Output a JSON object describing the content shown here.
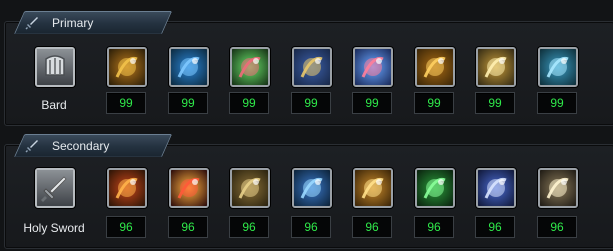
{
  "primary": {
    "header": "Primary",
    "class_name": "Bard",
    "class_icon": "harp-icon",
    "skills": [
      {
        "icon": "golden-horn-icon",
        "level": "99",
        "colors": [
          "#2a1d08",
          "#f2c24a",
          "#b7781c"
        ]
      },
      {
        "icon": "blue-burst-icon",
        "level": "99",
        "colors": [
          "#0c2a3f",
          "#7ec8ff",
          "#2a84d4"
        ]
      },
      {
        "icon": "heart-notes-icon",
        "level": "99",
        "colors": [
          "#153015",
          "#f06a7a",
          "#6adf6a"
        ]
      },
      {
        "icon": "lyre-icon",
        "level": "99",
        "colors": [
          "#182848",
          "#e9c86a",
          "#3c5fa8"
        ]
      },
      {
        "icon": "glowing-heart-icon",
        "level": "99",
        "colors": [
          "#1a2a5a",
          "#ff7e9a",
          "#6aa6ff"
        ]
      },
      {
        "icon": "golden-heart-icon",
        "level": "99",
        "colors": [
          "#3a2608",
          "#ffd060",
          "#a86a14"
        ]
      },
      {
        "icon": "sparkle-cross-icon",
        "level": "99",
        "colors": [
          "#332a14",
          "#fff0b0",
          "#c49a3a"
        ]
      },
      {
        "icon": "wind-swirl-icon",
        "level": "99",
        "colors": [
          "#0e2f3a",
          "#a8e8ff",
          "#3a9ac0"
        ]
      }
    ]
  },
  "secondary": {
    "header": "Secondary",
    "class_name": "Holy Sword",
    "class_icon": "sword-icon",
    "skills": [
      {
        "icon": "flaming-sword-icon",
        "level": "96",
        "colors": [
          "#2a1406",
          "#ffb24a",
          "#c8461a"
        ]
      },
      {
        "icon": "red-slash-icon",
        "level": "96",
        "colors": [
          "#2a0a0a",
          "#ff5a3a",
          "#ffb040"
        ]
      },
      {
        "icon": "planted-sword-icon",
        "level": "96",
        "colors": [
          "#2a220e",
          "#e8d08a",
          "#8a7038"
        ]
      },
      {
        "icon": "ice-shards-icon",
        "level": "96",
        "colors": [
          "#0c2238",
          "#9ad8ff",
          "#3a78c8"
        ]
      },
      {
        "icon": "light-pillar-icon",
        "level": "96",
        "colors": [
          "#3a2408",
          "#ffe08a",
          "#c88a2a"
        ]
      },
      {
        "icon": "green-power-ring-icon",
        "level": "96",
        "colors": [
          "#0a200e",
          "#8aff9a",
          "#2a9a3a"
        ]
      },
      {
        "icon": "lightning-sword-icon",
        "level": "96",
        "colors": [
          "#101838",
          "#d8e4ff",
          "#4a6ad0"
        ]
      },
      {
        "icon": "sword-wave-icon",
        "level": "96",
        "colors": [
          "#1e1a14",
          "#fff4d0",
          "#8a7a5a"
        ]
      }
    ]
  }
}
